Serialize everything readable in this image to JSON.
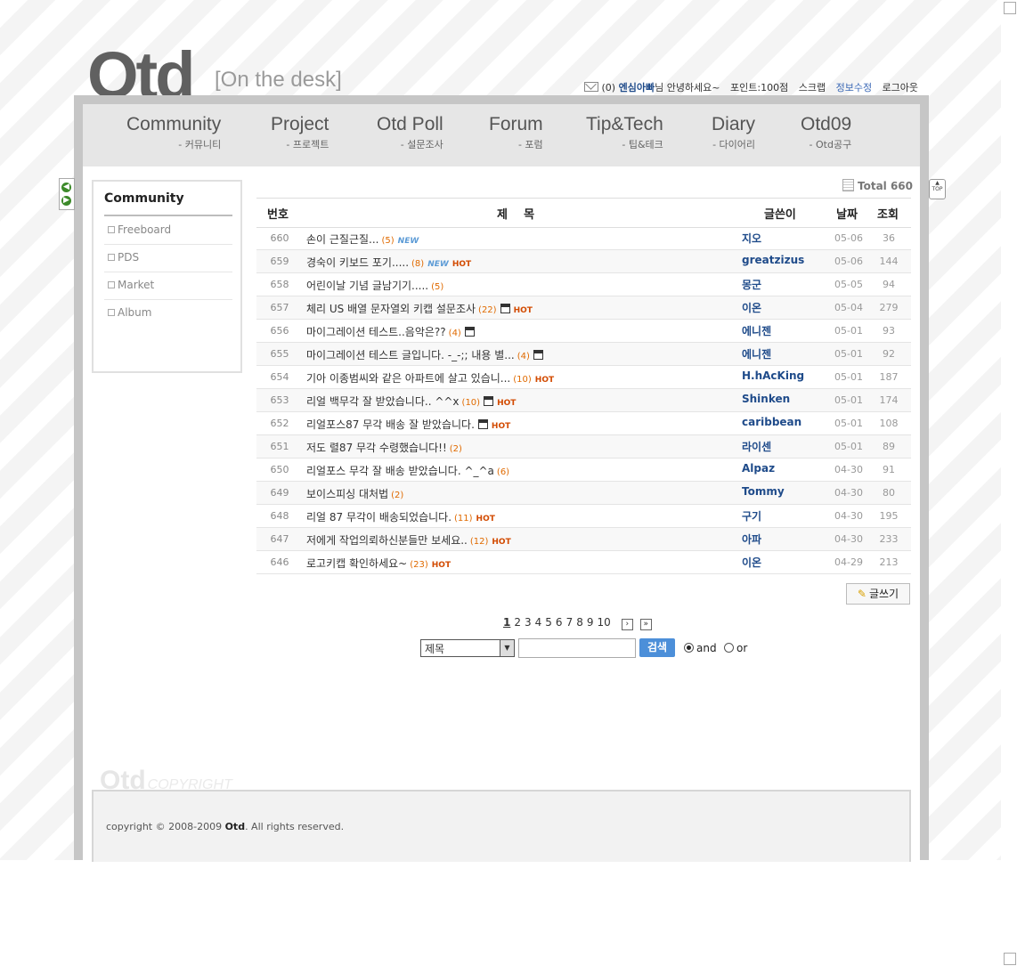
{
  "brand": {
    "logo": "Otd",
    "tagline": "[On the desk]"
  },
  "userbar": {
    "mail_count": "(0)",
    "nickname": "엔심아빠",
    "greeting": "님 안녕하세요~",
    "points": "포인트:100점",
    "scrap": "스크랩",
    "edit_info": "정보수정",
    "logout": "로그아웃"
  },
  "nav": [
    {
      "en": "Community",
      "ko": "- 커뮤니티"
    },
    {
      "en": "Project",
      "ko": "- 프로젝트"
    },
    {
      "en": "Otd Poll",
      "ko": "- 설문조사"
    },
    {
      "en": "Forum",
      "ko": "- 포럼"
    },
    {
      "en": "Tip&Tech",
      "ko": "- 팁&테크"
    },
    {
      "en": "Diary",
      "ko": "- 다이어리"
    },
    {
      "en": "Otd09",
      "ko": "- Otd공구"
    }
  ],
  "top_button": "TOP",
  "sidebar": {
    "title": "Community",
    "items": [
      "Freeboard",
      "PDS",
      "Market",
      "Album"
    ]
  },
  "board": {
    "total_label": "Total 660",
    "headers": {
      "no": "번호",
      "subject": "제    목",
      "writer": "글쓴이",
      "date": "날짜",
      "views": "조회"
    },
    "rows": [
      {
        "no": "660",
        "subject": "손이 근질근질...",
        "count": "(5)",
        "new": true,
        "hot": false,
        "disk": false,
        "writer": "지오",
        "date": "05-06",
        "views": "36"
      },
      {
        "no": "659",
        "subject": "경숙이 키보드 포기.....",
        "count": "(8)",
        "new": true,
        "hot": true,
        "disk": false,
        "writer": "greatzizus",
        "date": "05-06",
        "views": "144"
      },
      {
        "no": "658",
        "subject": "어린이날 기념 글남기기.....",
        "count": "(5)",
        "new": false,
        "hot": false,
        "disk": false,
        "writer": "몽군",
        "date": "05-05",
        "views": "94"
      },
      {
        "no": "657",
        "subject": "체리 US 배열 문자열외 키캡 설문조사",
        "count": "(22)",
        "new": false,
        "hot": true,
        "disk": true,
        "writer": "이온",
        "date": "05-04",
        "views": "279"
      },
      {
        "no": "656",
        "subject": "마이그레이션 테스트..음악은??",
        "count": "(4)",
        "new": false,
        "hot": false,
        "disk": true,
        "writer": "에니젠",
        "date": "05-01",
        "views": "93"
      },
      {
        "no": "655",
        "subject": "마이그레이션 테스트 글입니다. -_-;; 내용 별...",
        "count": "(4)",
        "new": false,
        "hot": false,
        "disk": true,
        "writer": "에니젠",
        "date": "05-01",
        "views": "92"
      },
      {
        "no": "654",
        "subject": "기아 이종범씨와 같은 아파트에 살고 있습니...",
        "count": "(10)",
        "new": false,
        "hot": true,
        "disk": false,
        "writer": "H.hAcKing",
        "date": "05-01",
        "views": "187"
      },
      {
        "no": "653",
        "subject": "리얼 백무각 잘 받았습니다.. ^^x",
        "count": "(10)",
        "new": false,
        "hot": true,
        "disk": true,
        "writer": "Shinken",
        "date": "05-01",
        "views": "174"
      },
      {
        "no": "652",
        "subject": "리얼포스87 무각 배송 잘 받았습니다.",
        "count": "",
        "new": false,
        "hot": true,
        "disk": true,
        "writer": "caribbean",
        "date": "05-01",
        "views": "108"
      },
      {
        "no": "651",
        "subject": "저도 렬87 무각 수령했습니다!!",
        "count": "(2)",
        "new": false,
        "hot": false,
        "disk": false,
        "writer": "라이센",
        "date": "05-01",
        "views": "89"
      },
      {
        "no": "650",
        "subject": "리얼포스 무각 잘 배송 받았습니다. ^_^a",
        "count": "(6)",
        "new": false,
        "hot": false,
        "disk": false,
        "writer": "Alpaz",
        "date": "04-30",
        "views": "91"
      },
      {
        "no": "649",
        "subject": "보이스피싱 대처법",
        "count": "(2)",
        "new": false,
        "hot": false,
        "disk": false,
        "writer": "Tommy",
        "date": "04-30",
        "views": "80"
      },
      {
        "no": "648",
        "subject": "리얼 87 무각이 배송되었습니다.",
        "count": "(11)",
        "new": false,
        "hot": true,
        "disk": false,
        "writer": "구기",
        "date": "04-30",
        "views": "195"
      },
      {
        "no": "647",
        "subject": "저에게 작업의뢰하신분들만 보세요..",
        "count": "(12)",
        "new": false,
        "hot": true,
        "disk": false,
        "writer": "아파",
        "date": "04-30",
        "views": "233"
      },
      {
        "no": "646",
        "subject": "로고키캡 확인하세요~",
        "count": "(23)",
        "new": false,
        "hot": true,
        "disk": false,
        "writer": "이온",
        "date": "04-29",
        "views": "213"
      }
    ],
    "write_button": "글쓰기",
    "pages": [
      "1",
      "2",
      "3",
      "4",
      "5",
      "6",
      "7",
      "8",
      "9",
      "10"
    ],
    "current_page": "1"
  },
  "search": {
    "field_selected": "제목",
    "button": "검색",
    "opt_and": "and",
    "opt_or": "or"
  },
  "footer": {
    "logo": "Otd",
    "logo_sub": "COPYRIGHT",
    "copyright_prefix": "copyright © 2008-2009 ",
    "copyright_brand": "Otd",
    "copyright_suffix": ". All rights reserved."
  },
  "icons": {
    "new": "NEW",
    "hot": "HOT",
    "disk": "disk-icon"
  },
  "colors": {
    "accent": "#1f4b8a",
    "count": "#e06a00",
    "hot": "#d24a00",
    "new": "#5c9bd6"
  }
}
